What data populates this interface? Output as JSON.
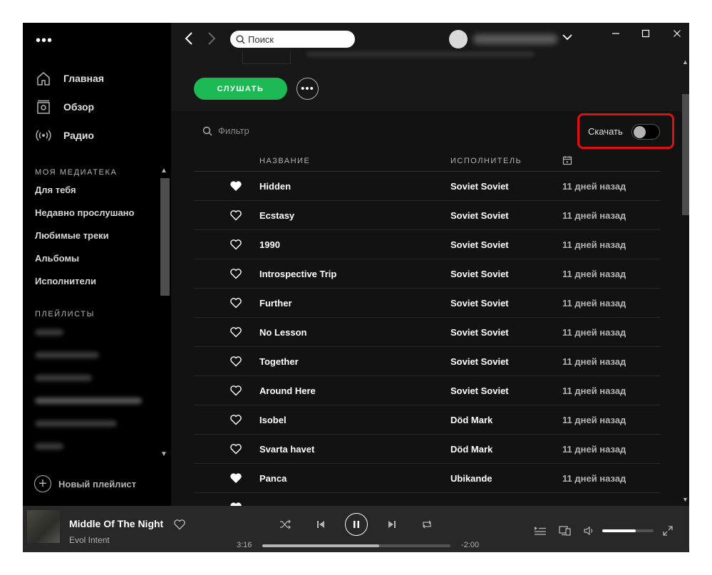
{
  "window": {
    "minimize_icon": "minimize-icon",
    "maximize_icon": "maximize-icon",
    "close_icon": "close-icon"
  },
  "sidebar": {
    "menu_dots": "•••",
    "nav": [
      {
        "label": "Главная",
        "icon": "home-icon"
      },
      {
        "label": "Обзор",
        "icon": "browse-icon"
      },
      {
        "label": "Радио",
        "icon": "radio-icon"
      }
    ],
    "library_title": "МОЯ МЕДИАТЕКА",
    "library": [
      "Для тебя",
      "Недавно прослушано",
      "Любимые треки",
      "Альбомы",
      "Исполнители"
    ],
    "playlists_title": "ПЛЕЙЛИСТЫ",
    "new_playlist": "Новый плейлист"
  },
  "topbar": {
    "search_placeholder": "Поиск"
  },
  "main": {
    "play_button": "СЛУШАТЬ",
    "more_button": "•••",
    "filter_placeholder": "Фильтр",
    "download_label": "Скачать",
    "download_enabled": false,
    "columns": {
      "title": "НАЗВАНИЕ",
      "artist": "ИСПОЛНИТЕЛЬ",
      "date_icon": "calendar-icon"
    },
    "tracks": [
      {
        "title": "Hidden",
        "artist": "Soviet Soviet",
        "added": "11 дней назад",
        "liked": true
      },
      {
        "title": "Ecstasy",
        "artist": "Soviet Soviet",
        "added": "11 дней назад",
        "liked": false
      },
      {
        "title": "1990",
        "artist": "Soviet Soviet",
        "added": "11 дней назад",
        "liked": false
      },
      {
        "title": "Introspective Trip",
        "artist": "Soviet Soviet",
        "added": "11 дней назад",
        "liked": false
      },
      {
        "title": "Further",
        "artist": "Soviet Soviet",
        "added": "11 дней назад",
        "liked": false
      },
      {
        "title": "No Lesson",
        "artist": "Soviet Soviet",
        "added": "11 дней назад",
        "liked": false
      },
      {
        "title": "Together",
        "artist": "Soviet Soviet",
        "added": "11 дней назад",
        "liked": false
      },
      {
        "title": "Around Here",
        "artist": "Soviet Soviet",
        "added": "11 дней назад",
        "liked": false
      },
      {
        "title": "Isobel",
        "artist": "Död Mark",
        "added": "11 дней назад",
        "liked": false
      },
      {
        "title": "Svarta havet",
        "artist": "Död Mark",
        "added": "11 дней назад",
        "liked": false
      },
      {
        "title": "Panca",
        "artist": "Ubikande",
        "added": "11 дней назад",
        "liked": true
      }
    ]
  },
  "player": {
    "track_title": "Middle Of The Night",
    "track_artist": "Evol Intent",
    "elapsed": "3:16",
    "remaining": "-2:00",
    "progress_fraction": 0.62,
    "volume_fraction": 0.65,
    "is_playing": true
  }
}
